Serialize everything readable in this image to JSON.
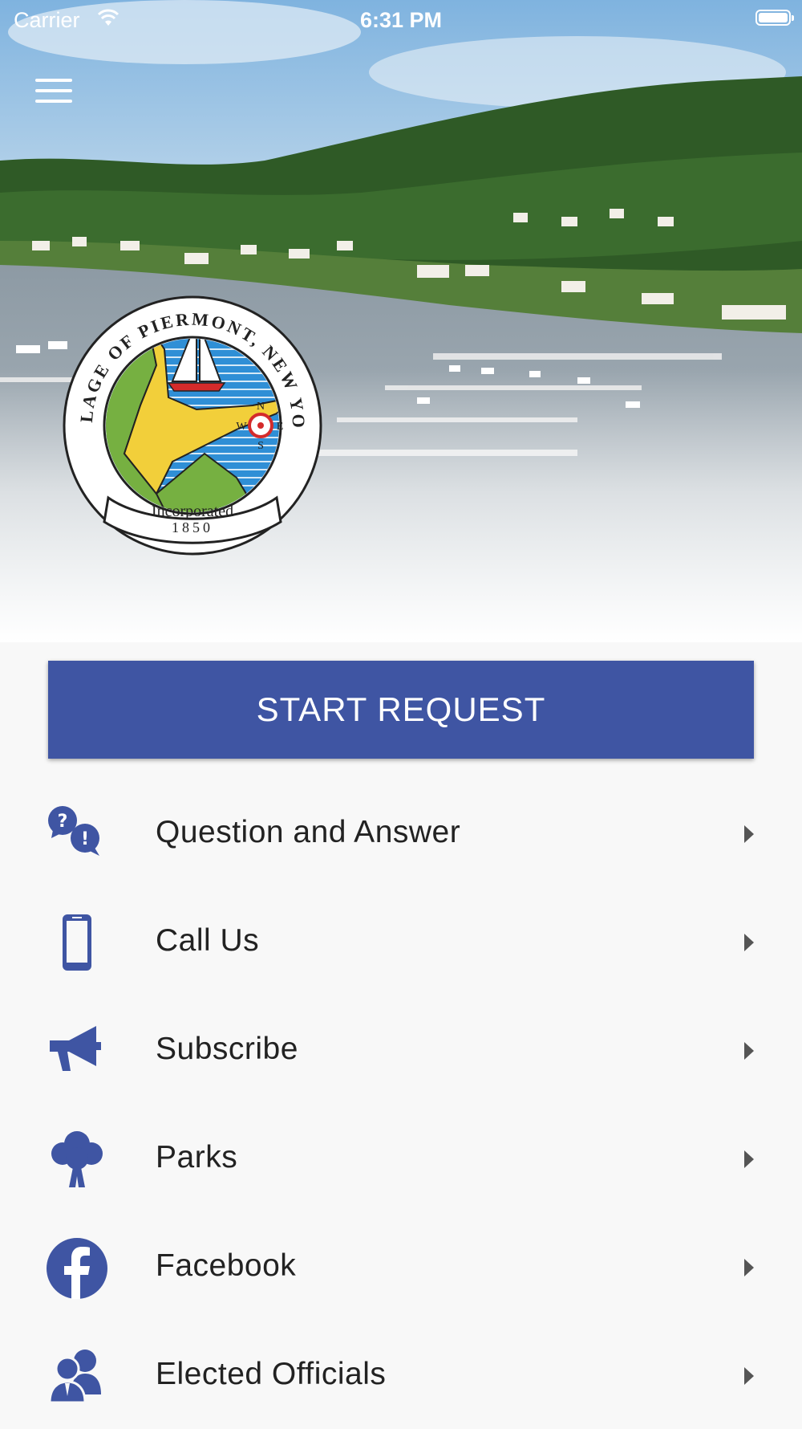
{
  "status_bar": {
    "carrier": "Carrier",
    "time": "6:31 PM"
  },
  "hero": {
    "seal": {
      "ring_text": "VILLAGE OF PIERMONT, NEW YORK",
      "banner_line1": "Incorporated",
      "banner_line2": "1850",
      "compass": [
        "N",
        "E",
        "S",
        "W"
      ]
    }
  },
  "start_request": {
    "label": "START REQUEST"
  },
  "menu_items": [
    {
      "label": "Question and Answer",
      "icon": "question-answer-icon"
    },
    {
      "label": "Call Us",
      "icon": "phone-icon"
    },
    {
      "label": "Subscribe",
      "icon": "megaphone-icon"
    },
    {
      "label": "Parks",
      "icon": "tree-icon"
    },
    {
      "label": "Facebook",
      "icon": "facebook-icon"
    },
    {
      "label": "Elected Officials",
      "icon": "officials-icon"
    }
  ],
  "colors": {
    "accent": "#3f55a3",
    "text": "#222222",
    "background": "#f8f8f8"
  }
}
